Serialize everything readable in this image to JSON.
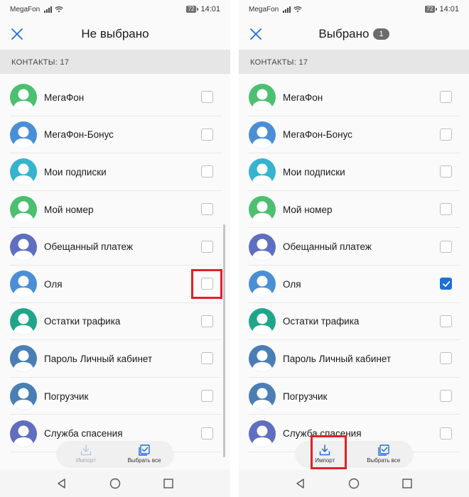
{
  "status_bar": {
    "carrier": "MegaFon",
    "battery": "72",
    "time": "14:01"
  },
  "panels": [
    {
      "id": "left",
      "title": "Не выбрано",
      "badge": null,
      "section_label": "КОНТАКТЫ: 17",
      "checked": [
        false,
        false,
        false,
        false,
        false,
        false,
        false,
        false,
        false,
        false
      ],
      "actions": {
        "import_label": "Импорт",
        "import_enabled": false,
        "select_all_label": "Выбрать все"
      }
    },
    {
      "id": "right",
      "title": "Выбрано",
      "badge": "1",
      "section_label": "КОНТАКТЫ: 17",
      "checked": [
        false,
        false,
        false,
        false,
        false,
        true,
        false,
        false,
        false,
        false
      ],
      "actions": {
        "import_label": "Импорт",
        "import_enabled": true,
        "select_all_label": "Выбрать все"
      }
    }
  ],
  "contacts": [
    {
      "name": "МегаФон",
      "color": "#4cbf70"
    },
    {
      "name": "МегаФон-Бонус",
      "color": "#4a8fd6"
    },
    {
      "name": "Мои подписки",
      "color": "#35b3cf"
    },
    {
      "name": "Мой номер",
      "color": "#4cbf70"
    },
    {
      "name": "Обещанный платеж",
      "color": "#5f6ec0"
    },
    {
      "name": "Оля",
      "color": "#4a8fd6"
    },
    {
      "name": "Остатки трафика",
      "color": "#1fa68a"
    },
    {
      "name": "Пароль Личный кабинет",
      "color": "#4a7fb5"
    },
    {
      "name": "Погрузчик",
      "color": "#4a7fb5"
    },
    {
      "name": "Служба спасения",
      "color": "#5f6ec0"
    }
  ],
  "colors": {
    "accent": "#1e6fd9",
    "highlight": "#e12027",
    "section_bg": "#e6e6e6"
  },
  "icons": [
    "close-icon",
    "import-icon",
    "select-all-icon",
    "back-icon",
    "home-icon",
    "recents-icon",
    "checkmark-icon",
    "avatar-icon",
    "signal-icon",
    "wifi-icon"
  ]
}
